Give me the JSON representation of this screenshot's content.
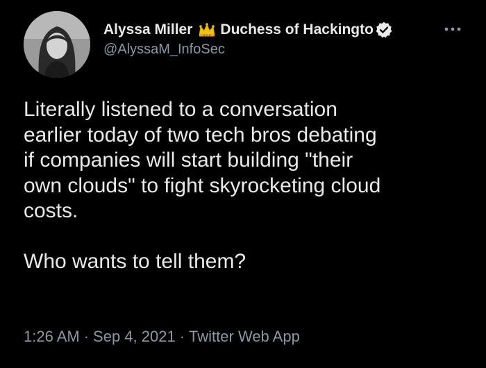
{
  "author": {
    "display_name": "Alyssa Miller",
    "title": "Duchess of Hackingto",
    "handle": "@AlyssaM_InfoSec",
    "crown_icon": "crown-emoji-icon",
    "verified_icon": "verified-badge-icon"
  },
  "tweet": {
    "text": "Literally listened to a conversation\nearlier today of two tech bros debating\nif companies will start building \"their\nown clouds\" to fight skyrocketing cloud\ncosts.\n\nWho wants to tell them?"
  },
  "meta": {
    "time": "1:26 AM",
    "separator": "·",
    "date": "Sep 4, 2021",
    "source": "Twitter Web App"
  },
  "colors": {
    "background": "#000000",
    "primary_text": "#e7e9ea",
    "secondary_text": "#8b98a5"
  }
}
